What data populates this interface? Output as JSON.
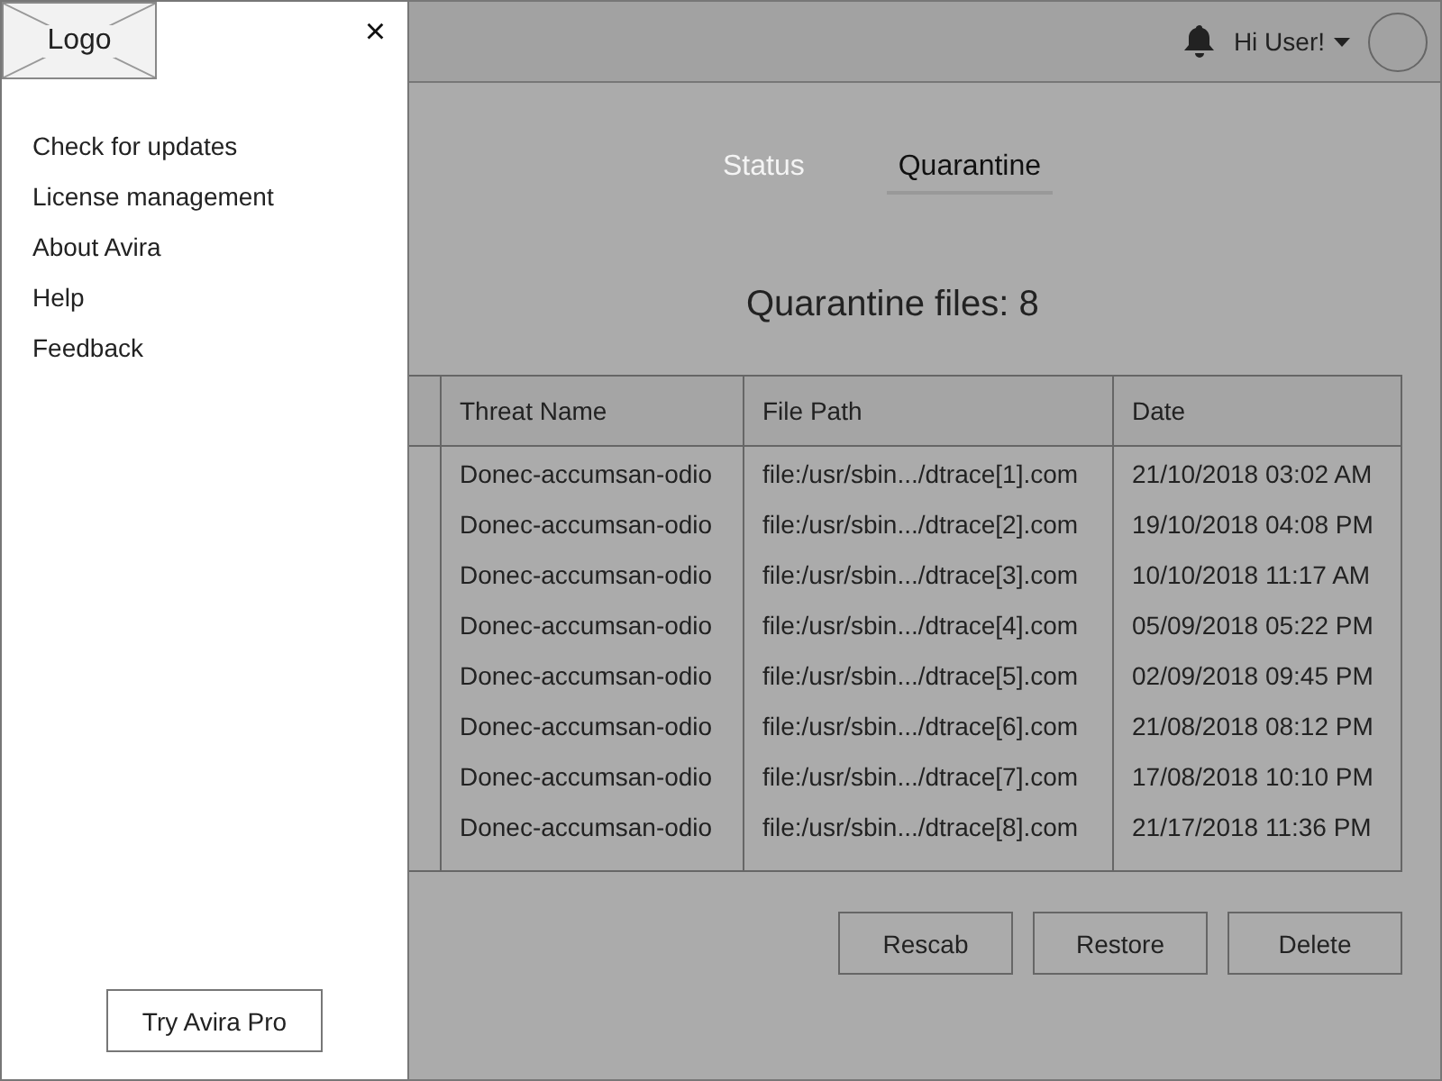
{
  "drawer": {
    "logo": "Logo",
    "close": "×",
    "menu": [
      "Check for updates",
      "License management",
      "About Avira",
      "Help",
      "Feedback"
    ],
    "cta": "Try Avira Pro"
  },
  "header": {
    "greeting": "Hi User!"
  },
  "tabs": [
    {
      "label": "Status",
      "selected": false
    },
    {
      "label": "Quarantine",
      "selected": true
    }
  ],
  "title": "Quarantine files: 8",
  "table": {
    "columns": [
      "Threat Name",
      "File Path",
      "Date"
    ],
    "rows": [
      [
        "Donec-accumsan-odio",
        "file:/usr/sbin.../dtrace[1].com",
        "21/10/2018 03:02 AM"
      ],
      [
        "Donec-accumsan-odio",
        "file:/usr/sbin.../dtrace[2].com",
        "19/10/2018 04:08 PM"
      ],
      [
        "Donec-accumsan-odio",
        "file:/usr/sbin.../dtrace[3].com",
        "10/10/2018 11:17 AM"
      ],
      [
        "Donec-accumsan-odio",
        "file:/usr/sbin.../dtrace[4].com",
        "05/09/2018 05:22 PM"
      ],
      [
        "Donec-accumsan-odio",
        "file:/usr/sbin.../dtrace[5].com",
        "02/09/2018 09:45 PM"
      ],
      [
        "Donec-accumsan-odio",
        "file:/usr/sbin.../dtrace[6].com",
        "21/08/2018 08:12 PM"
      ],
      [
        "Donec-accumsan-odio",
        "file:/usr/sbin.../dtrace[7].com",
        "17/08/2018 10:10 PM"
      ],
      [
        "Donec-accumsan-odio",
        "file:/usr/sbin.../dtrace[8].com",
        "21/17/2018 11:36 PM"
      ]
    ]
  },
  "buttons": [
    "Rescab",
    "Restore",
    "Delete"
  ]
}
